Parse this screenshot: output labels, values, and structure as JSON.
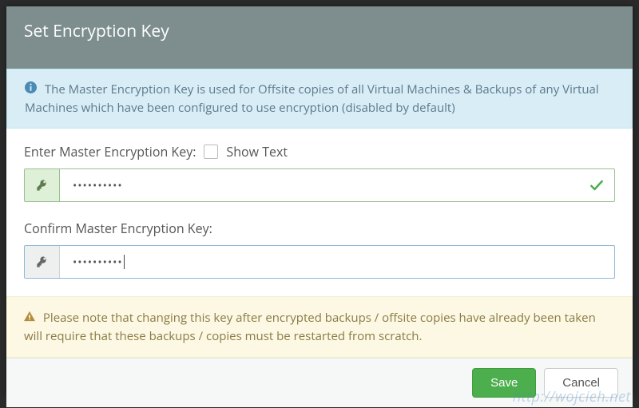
{
  "header": {
    "title": "Set Encryption Key"
  },
  "info": {
    "text": "The Master Encryption Key is used for Offsite copies of all Virtual Machines & Backups of any Virtual Machines which have been configured to use encryption (disabled by default)"
  },
  "form": {
    "enter_label": "Enter Master Encryption Key:",
    "show_text_label": "Show Text",
    "enter_value": "••••••••••",
    "confirm_label": "Confirm Master Encryption Key:",
    "confirm_value": "••••••••••"
  },
  "warning": {
    "text": "Please note that changing this key after encrypted backups / offsite copies have already been taken will require that these backups / copies must be restarted from scratch."
  },
  "footer": {
    "save_label": "Save",
    "cancel_label": "Cancel"
  },
  "watermark": "http://wojcieh.net"
}
